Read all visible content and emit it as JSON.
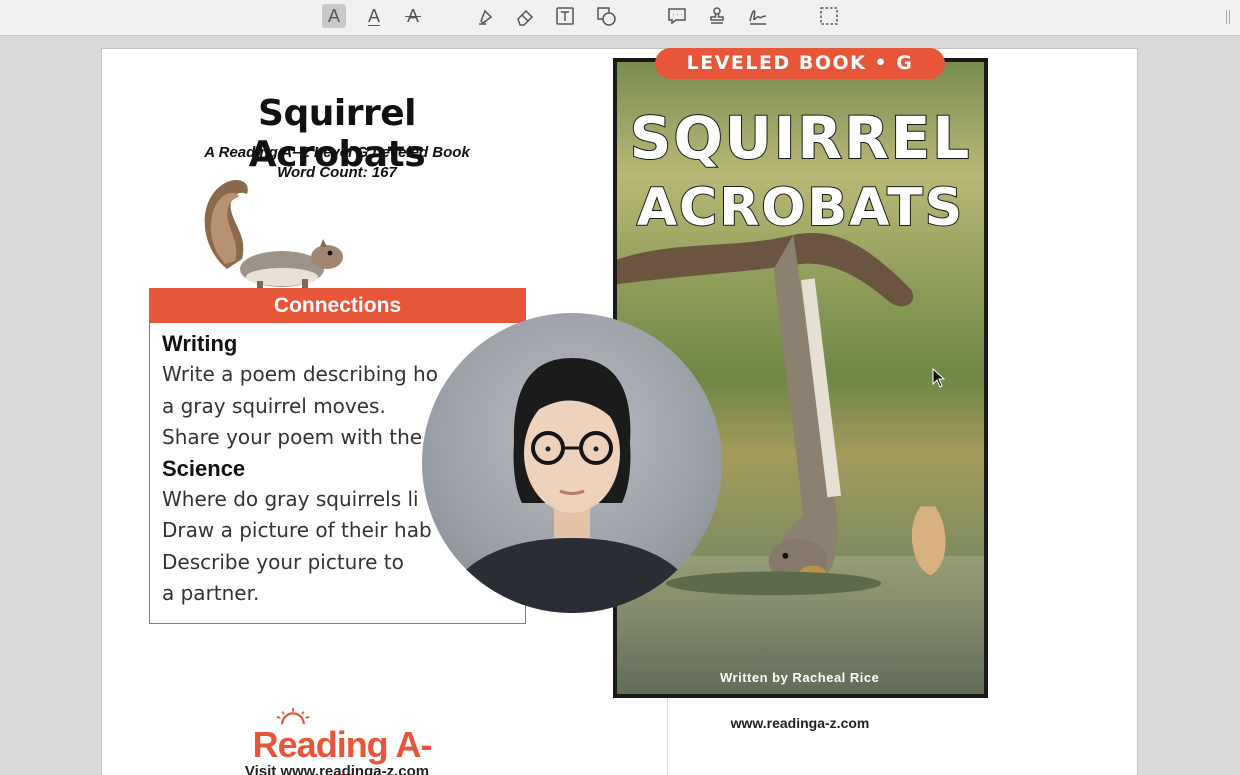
{
  "toolbar": {
    "tools": [
      {
        "name": "text-highlight-tool",
        "glyph": "A"
      },
      {
        "name": "text-underline-tool",
        "glyph": "A"
      },
      {
        "name": "text-strikethrough-tool",
        "glyph": "A"
      }
    ]
  },
  "left_page": {
    "title": "Squirrel Acrobats",
    "subtitle_line1": "A Reading A–Z Level G Leveled Book",
    "subtitle_line2": "Word Count: 167",
    "connections": {
      "header": "Connections",
      "sections": [
        {
          "heading": "Writing",
          "lines": [
            "Write a poem describing ho",
            "a gray squirrel moves.",
            "Share your poem with the"
          ]
        },
        {
          "heading": "Science",
          "lines": [
            "Where do gray squirrels li",
            "Draw a picture of their hab",
            "Describe your picture to",
            "a partner."
          ]
        }
      ]
    },
    "logo_text": "Reading A-Z",
    "visit_text": "Visit www.readinga-z.com"
  },
  "cover": {
    "badge": "LEVELED BOOK • G",
    "title_line1": "SQUIRREL",
    "title_line2": "ACROBATS",
    "author": "Written by Racheal Rice",
    "url": "www.readinga-z.com"
  },
  "colors": {
    "accent": "#e8563a",
    "toolbar_bg": "#f1f1f1",
    "background": "#d9d9d9"
  }
}
